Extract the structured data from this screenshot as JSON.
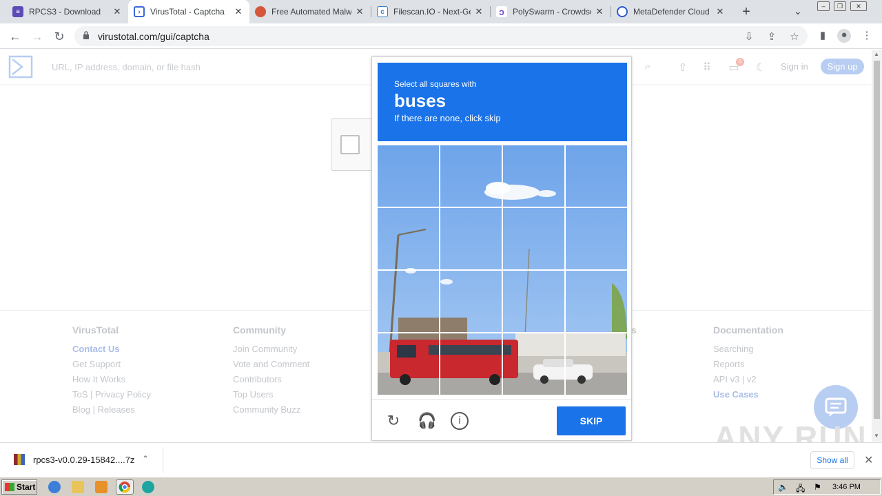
{
  "tabs": [
    {
      "title": "RPCS3 - Download",
      "favicon": "rpcs3-icon",
      "color": "#5b4bb5",
      "active": false
    },
    {
      "title": "VirusTotal - Captcha",
      "favicon": "virustotal-icon",
      "color": "#3a67d8",
      "active": true
    },
    {
      "title": "Free Automated Malwa",
      "favicon": "hybrid-analysis-icon",
      "color": "#d5563a",
      "active": false
    },
    {
      "title": "Filescan.IO - Next-Gen",
      "favicon": "filescan-icon",
      "color": "#2f80c8",
      "active": false
    },
    {
      "title": "PolySwarm - Crowdsou",
      "favicon": "polyswarm-icon",
      "color": "#7b4fd6",
      "active": false
    },
    {
      "title": "MetaDefender Cloud |",
      "favicon": "metadefender-icon",
      "color": "#2a5bd7",
      "active": false
    }
  ],
  "address_bar": {
    "url": "virustotal.com/gui/captcha"
  },
  "vt": {
    "search_placeholder": "URL, IP address, domain, or file hash",
    "notif_count": "6",
    "signin": "Sign in",
    "signup": "Sign up"
  },
  "recaptcha": {
    "instruction": "Select all squares with",
    "target": "buses",
    "sub": "If there are none, click skip",
    "skip": "SKIP"
  },
  "footer": {
    "col1": {
      "title": "VirusTotal",
      "links": [
        "Contact Us",
        "Get Support",
        "How It Works",
        "ToS | Privacy Policy",
        "Blog | Releases"
      ]
    },
    "col2": {
      "title": "Community",
      "links": [
        "Join Community",
        "Vote and Comment",
        "Contributors",
        "Top Users",
        "Community Buzz"
      ]
    },
    "col3_partial": "s",
    "col4": {
      "title": "Documentation",
      "links": [
        "Searching",
        "Reports",
        "API v3 | v2",
        "Use Cases"
      ]
    }
  },
  "download": {
    "file": "rpcs3-v0.0.29-15842....7z",
    "show_all": "Show all"
  },
  "taskbar": {
    "start": "Start",
    "clock": "3:46 PM"
  },
  "watermark": "ANY RUN"
}
